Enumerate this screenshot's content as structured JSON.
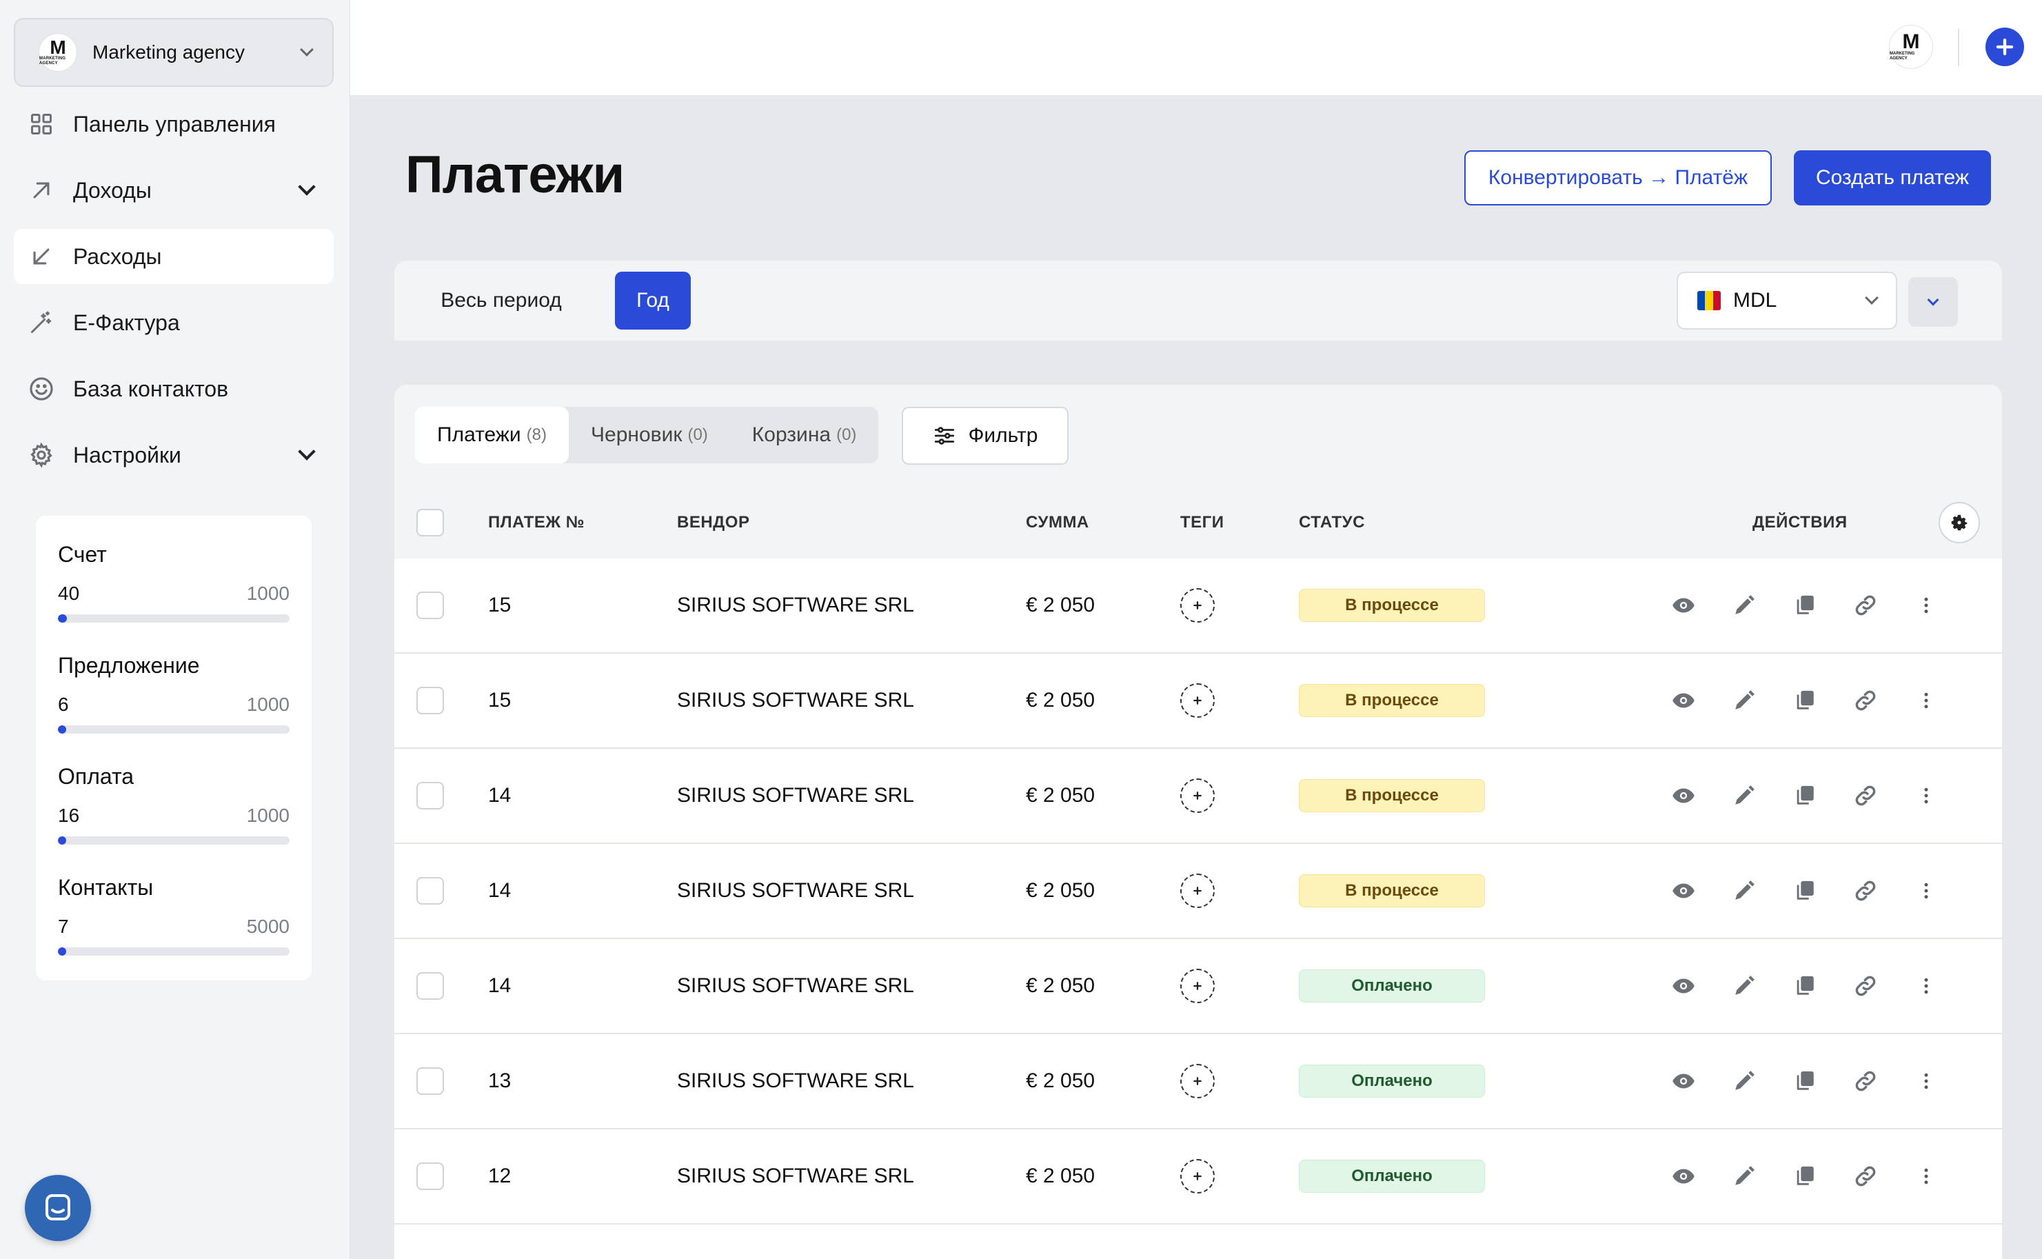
{
  "org": {
    "name": "Marketing agency",
    "logo_letter": "M",
    "logo_sub": "MARKETING AGENCY"
  },
  "sidebar": {
    "items": [
      {
        "label": "Панель управления",
        "icon": "grid-icon",
        "active": false,
        "expandable": false
      },
      {
        "label": "Доходы",
        "icon": "arrow-up-right-icon",
        "active": false,
        "expandable": true
      },
      {
        "label": "Расходы",
        "icon": "arrow-down-left-icon",
        "active": true,
        "expandable": false
      },
      {
        "label": "E-Фактура",
        "icon": "magic-wand-icon",
        "active": false,
        "expandable": false
      },
      {
        "label": "База контактов",
        "icon": "smile-icon",
        "active": false,
        "expandable": false
      },
      {
        "label": "Настройки",
        "icon": "gear-icon",
        "active": false,
        "expandable": true
      }
    ]
  },
  "usage": [
    {
      "title": "Счет",
      "used": "40",
      "limit": "1000",
      "fraction": 0.04
    },
    {
      "title": "Предложение",
      "used": "6",
      "limit": "1000",
      "fraction": 0.006
    },
    {
      "title": "Оплата",
      "used": "16",
      "limit": "1000",
      "fraction": 0.016
    },
    {
      "title": "Контакты",
      "used": "7",
      "limit": "5000",
      "fraction": 0.0014
    }
  ],
  "page": {
    "title": "Платежи"
  },
  "header": {
    "convert_label": "Конвертировать → Платёж",
    "create_label": "Создать платеж"
  },
  "period": {
    "all_label": "Весь период",
    "year_label": "Год",
    "selected": "Год"
  },
  "currency": {
    "code": "MDL",
    "flag_colors": [
      "#0046ae",
      "#ffd200",
      "#cc092f"
    ]
  },
  "tabs": [
    {
      "label": "Платежи",
      "count": "(8)",
      "active": true
    },
    {
      "label": "Черновик",
      "count": "(0)",
      "active": false
    },
    {
      "label": "Корзина",
      "count": "(0)",
      "active": false
    }
  ],
  "filter_label": "Фильтр",
  "table": {
    "columns": {
      "number": "ПЛАТЕЖ №",
      "vendor": "ВЕНДОР",
      "amount": "СУММА",
      "tags": "ТЕГИ",
      "status": "СТАТУС",
      "actions": "ДЕЙСТВИЯ"
    },
    "rows": [
      {
        "number": "15",
        "vendor": "SIRIUS SOFTWARE SRL",
        "amount": "€ 2 050",
        "status": "В процессе",
        "status_type": "progress"
      },
      {
        "number": "15",
        "vendor": "SIRIUS SOFTWARE SRL",
        "amount": "€ 2 050",
        "status": "В процессе",
        "status_type": "progress"
      },
      {
        "number": "14",
        "vendor": "SIRIUS SOFTWARE SRL",
        "amount": "€ 2 050",
        "status": "В процессе",
        "status_type": "progress"
      },
      {
        "number": "14",
        "vendor": "SIRIUS SOFTWARE SRL",
        "amount": "€ 2 050",
        "status": "В процессе",
        "status_type": "progress"
      },
      {
        "number": "14",
        "vendor": "SIRIUS SOFTWARE SRL",
        "amount": "€ 2 050",
        "status": "Оплачено",
        "status_type": "paid"
      },
      {
        "number": "13",
        "vendor": "SIRIUS SOFTWARE SRL",
        "amount": "€ 2 050",
        "status": "Оплачено",
        "status_type": "paid"
      },
      {
        "number": "12",
        "vendor": "SIRIUS SOFTWARE SRL",
        "amount": "€ 2 050",
        "status": "Оплачено",
        "status_type": "paid"
      }
    ]
  },
  "colors": {
    "accent": "#2a4bd7",
    "progress_bg": "#fdf2b8",
    "paid_bg": "#e1f6e6"
  }
}
